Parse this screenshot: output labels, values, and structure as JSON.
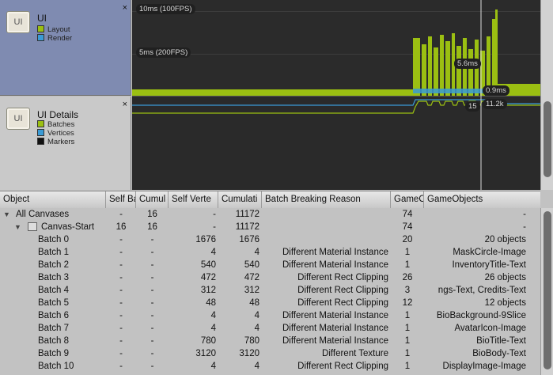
{
  "modules": {
    "ui": {
      "icon_label": "UI",
      "title": "UI",
      "legend": [
        {
          "label": "Layout",
          "color": "#9bbf12"
        },
        {
          "label": "Render",
          "color": "#3a9bd6"
        }
      ],
      "close": "×"
    },
    "details": {
      "icon_label": "UI",
      "title": "UI Details",
      "legend": [
        {
          "label": "Batches",
          "color": "#9bbf12"
        },
        {
          "label": "Vertices",
          "color": "#3a9bd6"
        },
        {
          "label": "Markers",
          "color": "#111111"
        }
      ],
      "close": "×"
    }
  },
  "chart": {
    "label_10ms": "10ms (100FPS)",
    "label_5ms": "5ms (200FPS)",
    "tip_a": "5.6ms",
    "tip_b": "0.9ms",
    "tip_c": "15",
    "tip_d": "11.2k"
  },
  "table": {
    "headers": [
      "Object",
      "Self Ba",
      "Cumul",
      "Self Verte",
      "Cumulati",
      "Batch Breaking Reason",
      "GameO",
      "GameObjects"
    ],
    "rows": [
      {
        "name": "All Canvases",
        "expander": "▼",
        "self_batch": "-",
        "cumul_batch": "16",
        "self_vert": "-",
        "cumul_vert": "11172",
        "reason": "",
        "go_count": "74",
        "gameobjects": "-"
      },
      {
        "name": "Canvas-Start",
        "expander": "▼",
        "self_batch": "16",
        "cumul_batch": "16",
        "self_vert": "-",
        "cumul_vert": "11172",
        "reason": "",
        "go_count": "74",
        "gameobjects": "-"
      },
      {
        "name": "Batch 0",
        "self_batch": "-",
        "cumul_batch": "-",
        "self_vert": "1676",
        "cumul_vert": "1676",
        "reason": "",
        "go_count": "20",
        "gameobjects": "20 objects"
      },
      {
        "name": "Batch 1",
        "self_batch": "-",
        "cumul_batch": "-",
        "self_vert": "4",
        "cumul_vert": "4",
        "reason": "Different Material Instance",
        "go_count": "1",
        "gameobjects": "MaskCircle-Image"
      },
      {
        "name": "Batch 2",
        "self_batch": "-",
        "cumul_batch": "-",
        "self_vert": "540",
        "cumul_vert": "540",
        "reason": "Different Material Instance",
        "go_count": "1",
        "gameobjects": "InventoryTitle-Text"
      },
      {
        "name": "Batch 3",
        "self_batch": "-",
        "cumul_batch": "-",
        "self_vert": "472",
        "cumul_vert": "472",
        "reason": "Different Rect Clipping",
        "go_count": "26",
        "gameobjects": "26 objects"
      },
      {
        "name": "Batch 4",
        "self_batch": "-",
        "cumul_batch": "-",
        "self_vert": "312",
        "cumul_vert": "312",
        "reason": "Different Rect Clipping",
        "go_count": "3",
        "gameobjects": "ngs-Text, Credits-Text"
      },
      {
        "name": "Batch 5",
        "self_batch": "-",
        "cumul_batch": "-",
        "self_vert": "48",
        "cumul_vert": "48",
        "reason": "Different Rect Clipping",
        "go_count": "12",
        "gameobjects": "12 objects"
      },
      {
        "name": "Batch 6",
        "self_batch": "-",
        "cumul_batch": "-",
        "self_vert": "4",
        "cumul_vert": "4",
        "reason": "Different Material Instance",
        "go_count": "1",
        "gameobjects": "BioBackground-9Slice"
      },
      {
        "name": "Batch 7",
        "self_batch": "-",
        "cumul_batch": "-",
        "self_vert": "4",
        "cumul_vert": "4",
        "reason": "Different Material Instance",
        "go_count": "1",
        "gameobjects": "AvatarIcon-Image"
      },
      {
        "name": "Batch 8",
        "self_batch": "-",
        "cumul_batch": "-",
        "self_vert": "780",
        "cumul_vert": "780",
        "reason": "Different Material Instance",
        "go_count": "1",
        "gameobjects": "BioTitle-Text"
      },
      {
        "name": "Batch 9",
        "self_batch": "-",
        "cumul_batch": "-",
        "self_vert": "3120",
        "cumul_vert": "3120",
        "reason": "Different Texture",
        "go_count": "1",
        "gameobjects": "BioBody-Text"
      },
      {
        "name": "Batch 10",
        "self_batch": "-",
        "cumul_batch": "-",
        "self_vert": "4",
        "cumul_vert": "4",
        "reason": "Different Rect Clipping",
        "go_count": "1",
        "gameobjects": "DisplayImage-Image"
      }
    ]
  },
  "colors": {
    "layout": "#9bbf12",
    "render": "#3a9bd6",
    "chart_bg": "#2b2b2b",
    "selected_module": "#7f8bb1"
  }
}
